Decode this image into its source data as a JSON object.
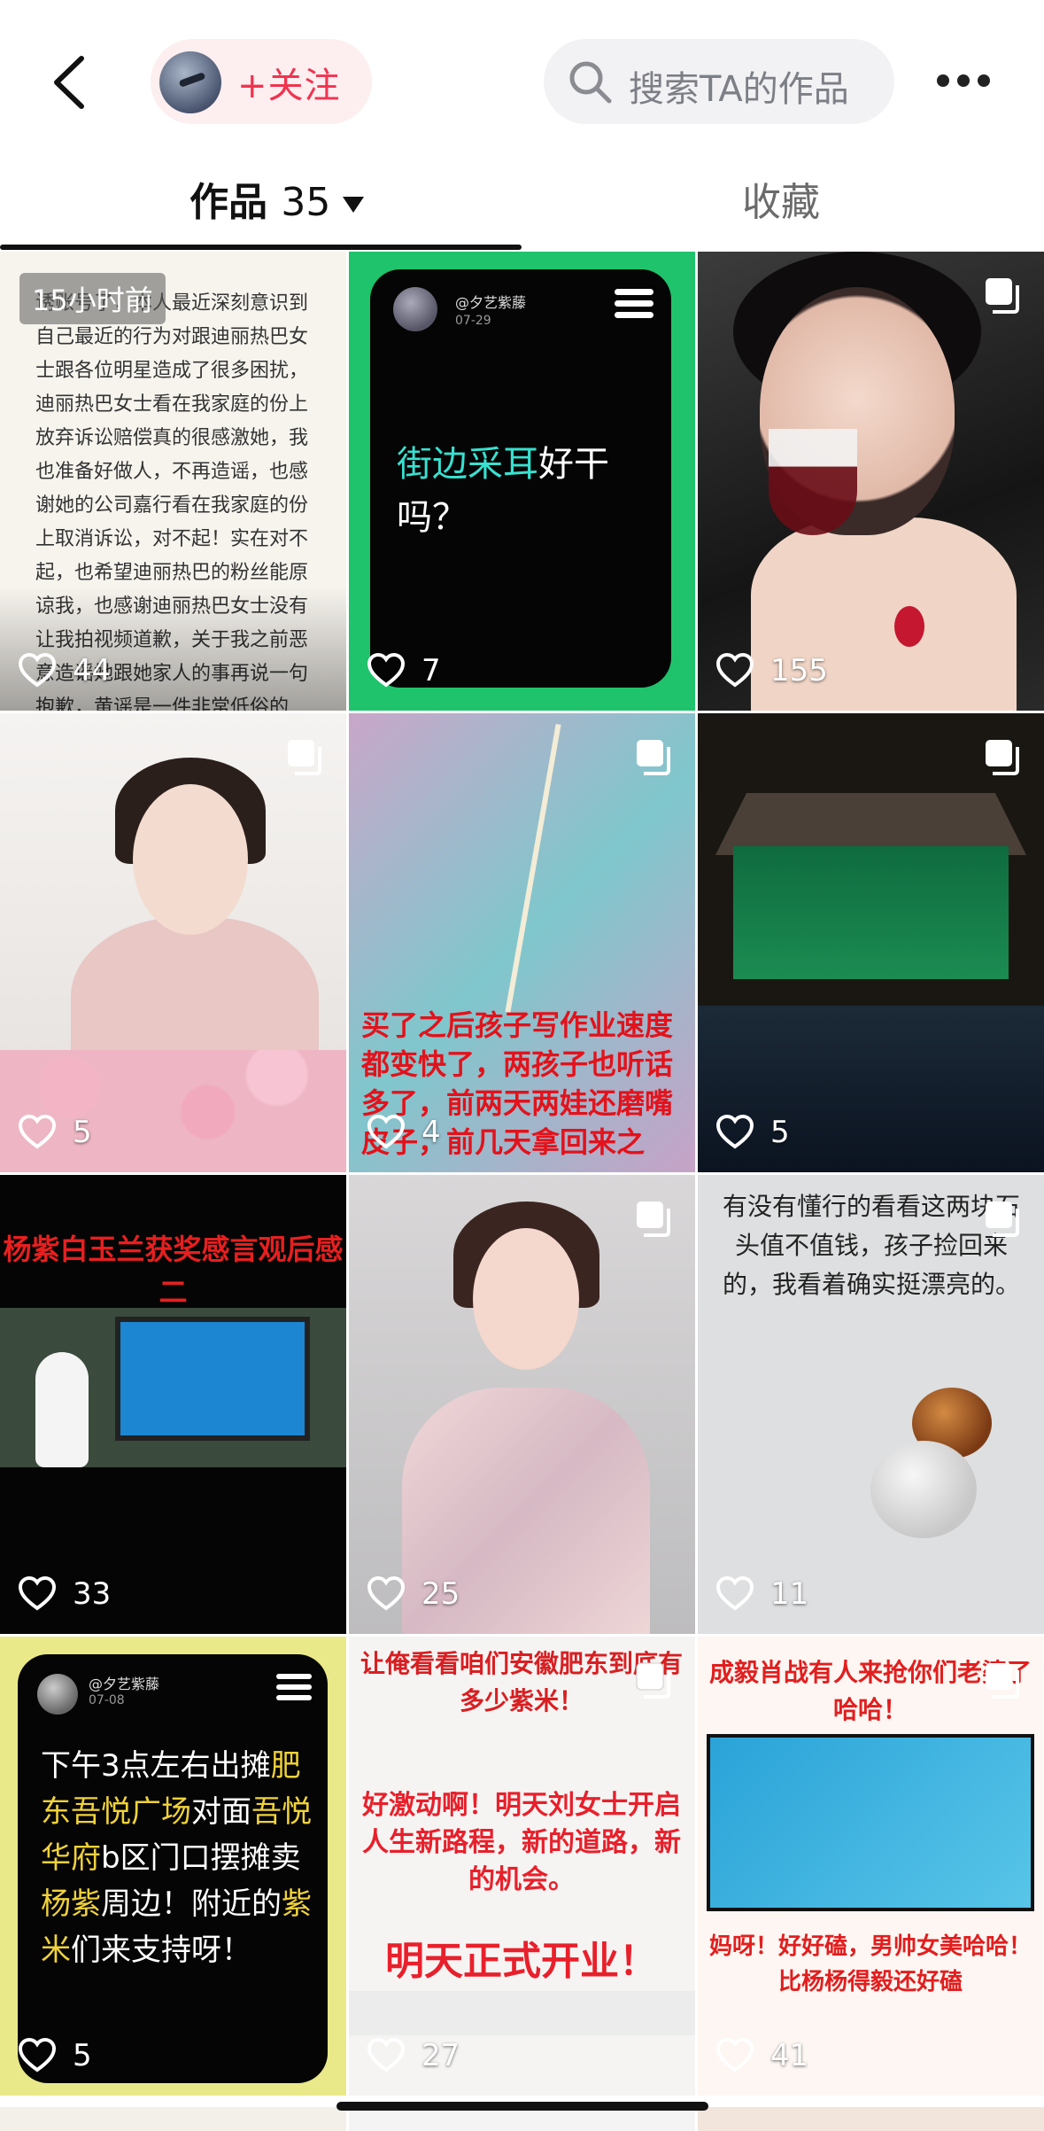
{
  "header": {
    "follow_label": "+关注",
    "search_placeholder": "搜索TA的作品"
  },
  "tabs": {
    "works_label": "作品",
    "works_count": "35",
    "favorites_label": "收藏"
  },
  "grid": {
    "items": [
      {
        "likes": "44",
        "badge": "15小时前",
        "text": "诱账号了，本人最近深刻意识到自己最近的行为对跟迪丽热巴女士跟各位明星造成了很多困扰，迪丽热巴女士看在我家庭的份上放弃诉讼赔偿真的很感激她，我也准备好做人，不再造谣，也感谢她的公司嘉行看在我家庭的份上取消诉讼，对不起！实在对不起，也希望迪丽热巴的粉丝能原谅我，也感谢迪丽热巴女士没有让我拍视频道歉，关于我之前恶意造谣她跟她家人的事再说一句抱歉，黄谣是一件非常低俗的事，我昨天才深刻意识到一句轻飘飘的玩笑能对别人带来这么大的烦恼，以后再也不会了，再说一句对不起，由于现在在外面，晚上回家也会写道歉书道歉，对不起对不起。"
      },
      {
        "likes": "7",
        "card_name": "@夕艺紫藤",
        "card_date": "07-29",
        "text_highlight": "街边采耳",
        "text_rest": "好干吗？"
      },
      {
        "likes": "155"
      },
      {
        "likes": "5"
      },
      {
        "likes": "4",
        "caption": "买了之后孩子写作业速度都变快了，两孩子也听话多了，前两天两娃还磨嘴皮子，前几天拿回来之"
      },
      {
        "likes": "5"
      },
      {
        "likes": "33",
        "caption": "杨紫白玉兰获奖感言观后感二"
      },
      {
        "likes": "25"
      },
      {
        "likes": "11",
        "caption": "有没有懂行的看看这两块石头值不值钱，孩子捡回来的，我看着确实挺漂亮的。"
      },
      {
        "likes": "5",
        "card_name": "@夕艺紫藤",
        "card_date": "07-08",
        "text_parts": [
          {
            "t": "下午3点左右出摊",
            "hl": false
          },
          {
            "t": "肥东吾悦广场",
            "hl": true
          },
          {
            "t": "对面",
            "hl": false
          },
          {
            "t": "吾悦华府",
            "hl": true
          },
          {
            "t": "b区门口摆摊卖",
            "hl": false
          },
          {
            "t": "杨紫",
            "hl": true
          },
          {
            "t": "周边！附近的",
            "hl": false
          },
          {
            "t": "紫米",
            "hl": true
          },
          {
            "t": "们来支持呀！",
            "hl": false
          }
        ]
      },
      {
        "likes": "27",
        "title": "让俺看看咱们安徽肥东到底有多少紫米！",
        "mid": "好激动啊！明天刘女士开启人生新路程，新的道路，新的机会。",
        "big": "明天正式开业！"
      },
      {
        "likes": "41",
        "title": "成毅肖战有人来抢你们老婆了哈哈！",
        "bottom": "妈呀！好好磕，男帅女美哈哈！比杨杨得毅还好磕"
      }
    ]
  }
}
